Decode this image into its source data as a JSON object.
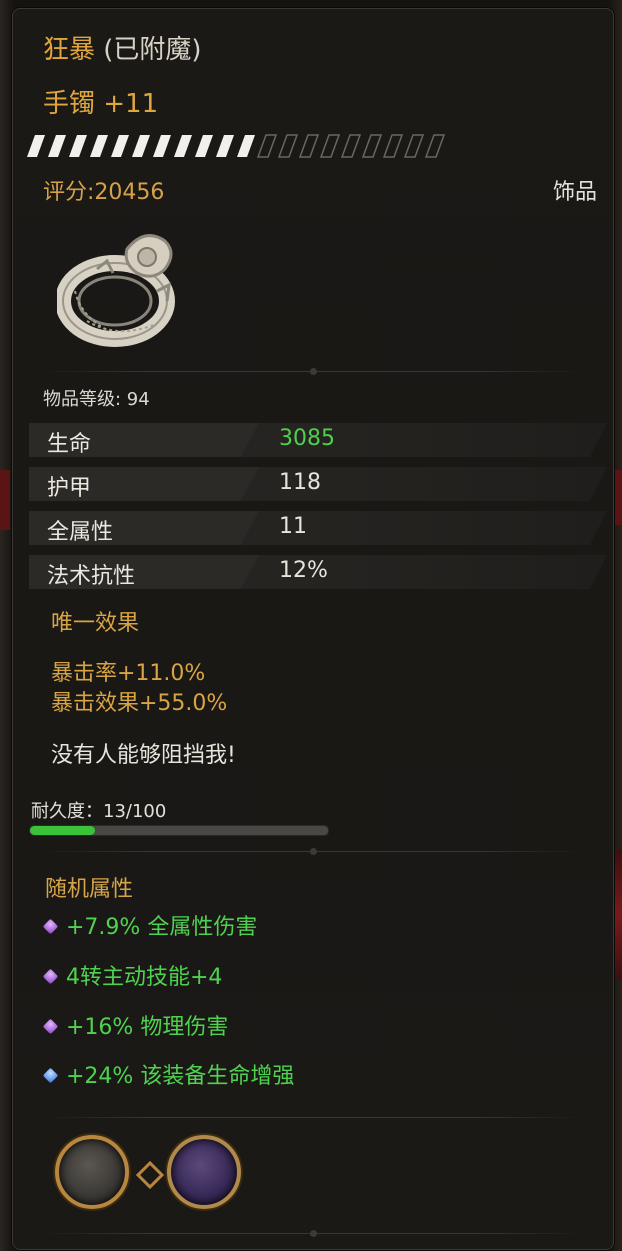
{
  "item": {
    "name": "狂暴",
    "enchant_status": " (已附魔)",
    "subtitle": "手镯 +11",
    "score": "评分:20456",
    "category": "饰品",
    "item_level": "物品等级: 94",
    "upgrade_bar": {
      "filled": 11,
      "total": 20
    },
    "icon": "bracelet-ring-icon"
  },
  "stats": [
    {
      "name": "生命",
      "value": "3085",
      "highlight": true
    },
    {
      "name": "护甲",
      "value": "118",
      "highlight": false
    },
    {
      "name": "全属性",
      "value": "11",
      "highlight": false
    },
    {
      "name": "法术抗性",
      "value": "12%",
      "highlight": false
    }
  ],
  "unique": {
    "title": "唯一效果",
    "lines": [
      "暴击率+11.0%",
      "暴击效果+55.0%"
    ],
    "flavor": "没有人能够阻挡我!"
  },
  "durability": {
    "label": "耐久度：13/100",
    "current": 13,
    "max": 100
  },
  "random": {
    "title": "随机属性",
    "lines": [
      {
        "text": "+7.9% 全属性伤害",
        "gem": "purple"
      },
      {
        "text": "4转主动技能+4",
        "gem": "purple"
      },
      {
        "text": "+16% 物理伤害",
        "gem": "purple"
      },
      {
        "text": "+24% 该装备生命增强",
        "gem": "blue"
      }
    ]
  },
  "sockets": [
    {
      "type": "empty"
    },
    {
      "type": "purple"
    }
  ],
  "colors": {
    "gold": "#e0a63e",
    "green": "#4dd14d",
    "panel": "#1b1916"
  }
}
